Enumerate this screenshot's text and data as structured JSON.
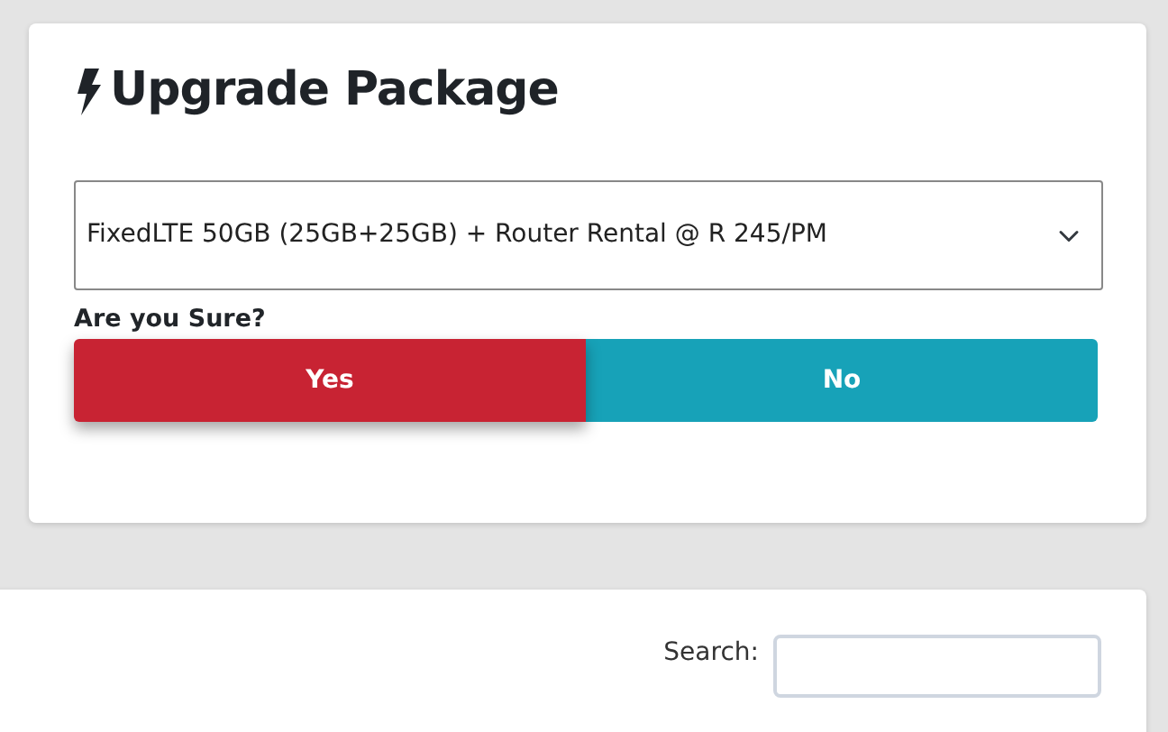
{
  "upgrade_card": {
    "title": "Upgrade Package",
    "package_select": {
      "value": "FixedLTE 50GB (25GB+25GB) + Router Rental @ R 245/PM"
    },
    "confirm_label": "Are you Sure?",
    "buttons": [
      {
        "label": "Yes",
        "kind": "danger",
        "selected": true
      },
      {
        "label": "No",
        "kind": "info",
        "selected": false
      }
    ]
  },
  "table_card": {
    "search_label": "Search:"
  }
}
